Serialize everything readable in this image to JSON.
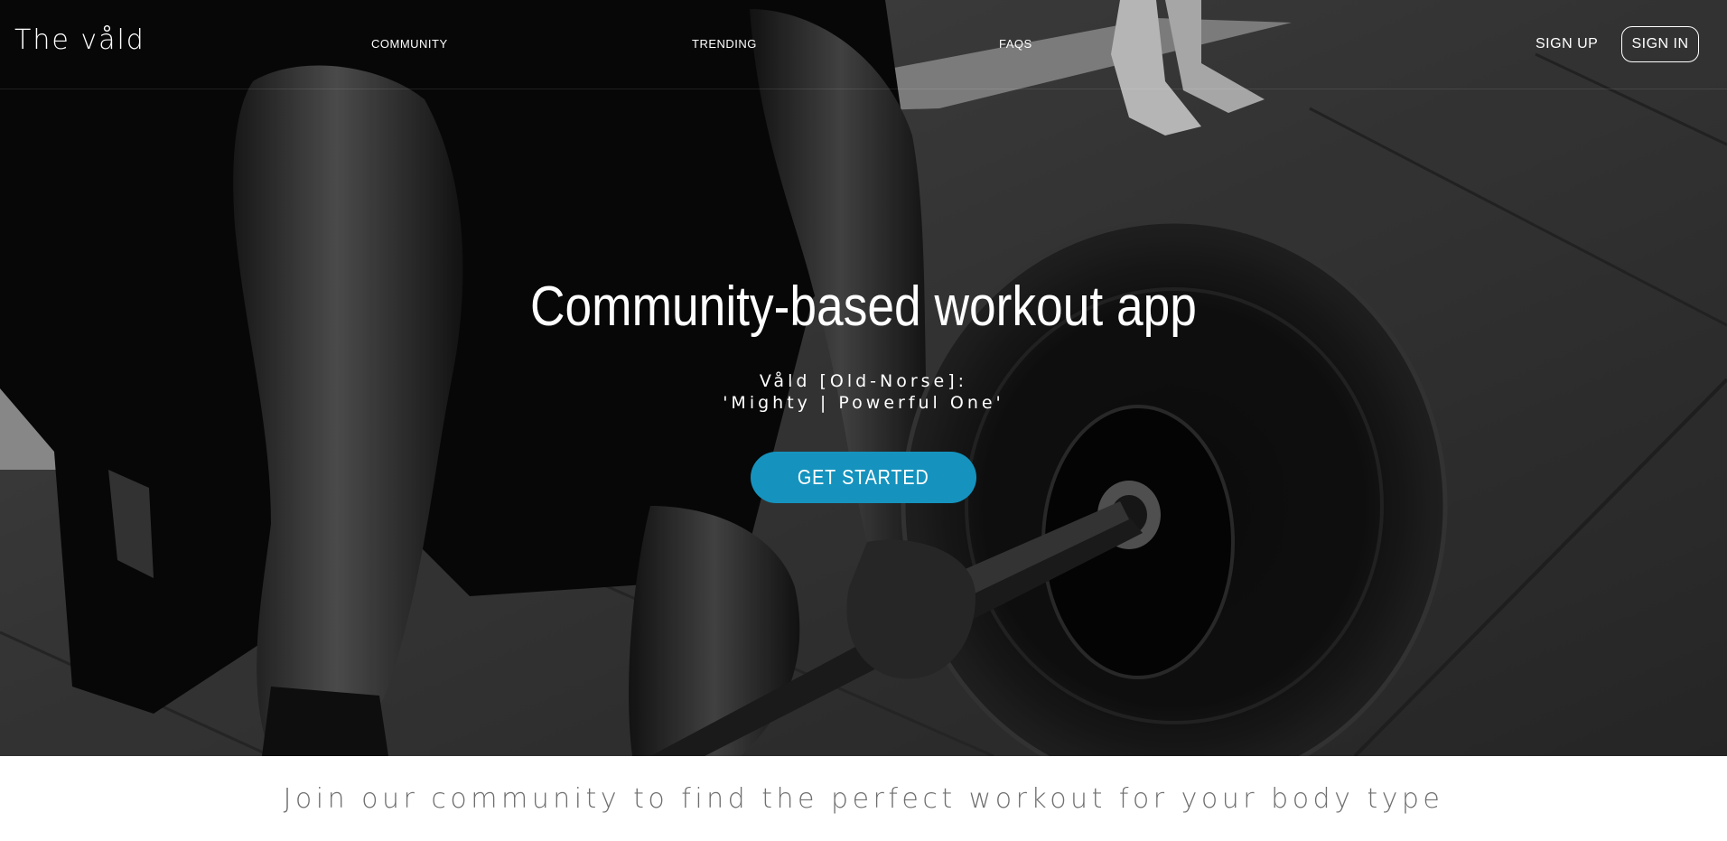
{
  "brand": {
    "name": "The våld"
  },
  "nav": {
    "links": [
      "COMMUNITY",
      "TRENDING",
      "FAQS"
    ],
    "signup_label": "SIGN UP",
    "signin_label": "SIGN IN"
  },
  "hero": {
    "title": "Community-based workout app",
    "subtitle_line1": "Våld [Old-Norse]:",
    "subtitle_line2": "'Mighty | Powerful One'",
    "cta_label": "GET STARTED"
  },
  "tagline": "Join our community to find the perfect workout for your body type",
  "colors": {
    "accent": "#1593be",
    "tagline_text": "#6f6f6f",
    "hero_text": "#ffffff"
  },
  "hero_image": "grayscale photo of athlete gripping a barbell for a deadlift"
}
